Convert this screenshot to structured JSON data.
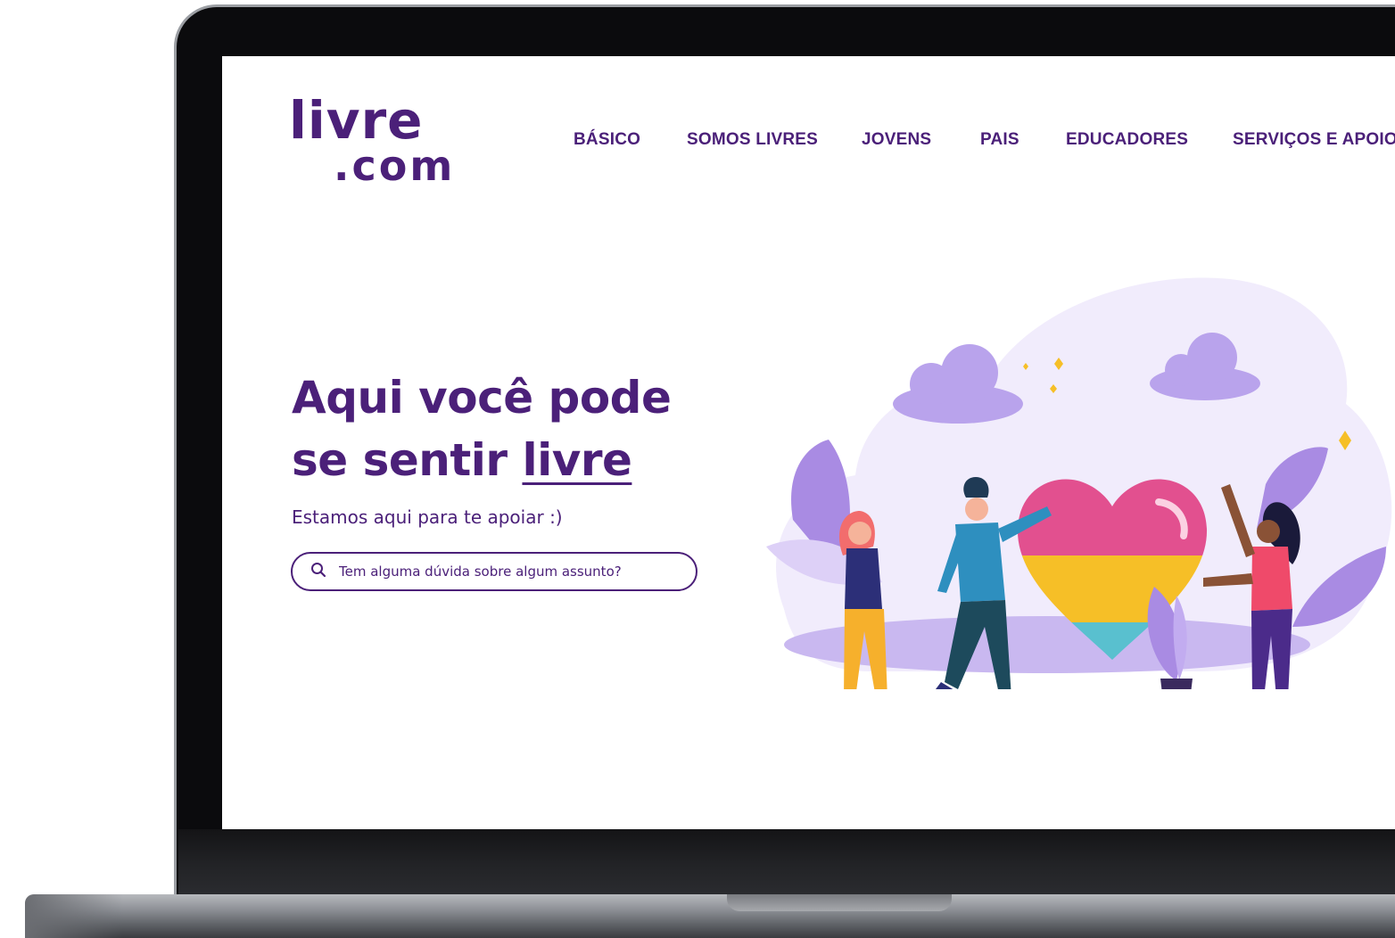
{
  "logo": {
    "line1": "livre",
    "line2": ".com"
  },
  "nav": {
    "items": [
      {
        "label": "BÁSICO"
      },
      {
        "label": "SOMOS LIVRES"
      },
      {
        "label": "JOVENS"
      },
      {
        "label": "PAIS"
      },
      {
        "label": "EDUCADORES"
      },
      {
        "label": "SERVIÇOS E APOIO"
      }
    ]
  },
  "hero": {
    "title_line1": "Aqui você pode",
    "title_line2_prefix": "se sentir ",
    "title_line2_highlight": "livre",
    "subtitle": "Estamos aqui para te apoiar :)"
  },
  "search": {
    "placeholder": "Tem alguma dúvida sobre algum assunto?",
    "icon": "search-icon"
  },
  "colors": {
    "brand_purple": "#4b2079",
    "lavender": "#c9b8f0",
    "heart_pink": "#e2508f",
    "heart_yellow": "#f6bf27",
    "heart_teal": "#59c0cf"
  }
}
